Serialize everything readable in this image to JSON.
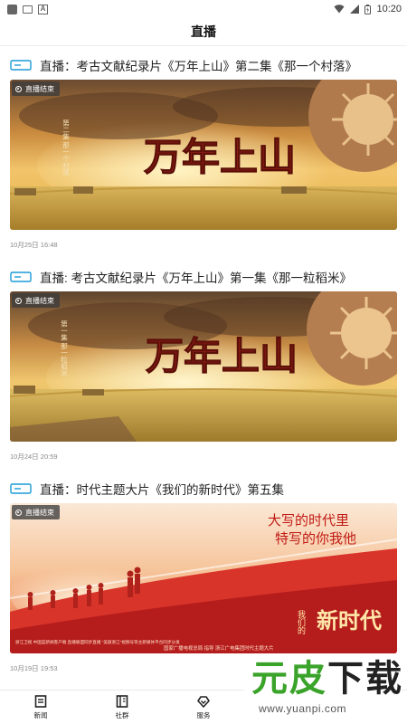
{
  "status_bar": {
    "time": "10:20",
    "icons": [
      "notification-icon",
      "gallery-icon",
      "a-icon",
      "wifi-icon",
      "signal-icon",
      "battery-icon"
    ]
  },
  "header": {
    "title": "直播"
  },
  "feed": [
    {
      "title": "直播：考古文献纪录片《万年上山》第二集《那一个村落》",
      "badge": "直播结束",
      "date": "10月25日 16:48",
      "thumb_title": "万年上山",
      "thumb_side": "第二集 那一个村落"
    },
    {
      "title": "直播: 考古文献纪录片《万年上山》第一集《那一粒稻米》",
      "badge": "直播结束",
      "date": "10月24日 20:59",
      "thumb_title": "万年上山",
      "thumb_side": "第一集 那一粒稻米"
    },
    {
      "title": "直播：时代主题大片《我们的新时代》第五集",
      "badge": "直播结束",
      "date": "10月19日 19:53",
      "thumb_line1": "大写的时代里",
      "thumb_line2": "特写的你我他",
      "thumb_logo_small": "我们的",
      "thumb_logo_big": "新时代",
      "thumb_footer_left": "浙江卫视  中国蓝新闻客户端  直播联盟同步直播  \"美丽浙江\"视频号等主新媒体平台同步分发",
      "thumb_footer_right": "国家广播电视总局  指导    浙江广电集团时代主题大片"
    }
  ],
  "bottom_nav": [
    {
      "label": "新闻",
      "icon": "news-icon"
    },
    {
      "label": "社群",
      "icon": "community-icon"
    },
    {
      "label": "服务",
      "icon": "service-icon"
    },
    {
      "label": "",
      "icon": ""
    },
    {
      "label": "",
      "icon": ""
    }
  ],
  "watermark": {
    "text_green": "元皮",
    "text_dark": "下载",
    "url": "www.yuanpi.com"
  },
  "colors": {
    "accent": "#1a9bd7",
    "badge_bg": "#3c3c3c",
    "watermark_green": "#3aa329"
  }
}
